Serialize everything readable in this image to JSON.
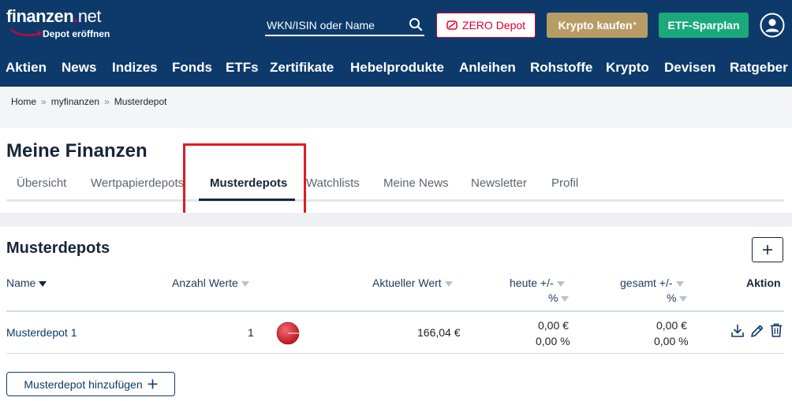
{
  "header": {
    "logo_text_main": "finanzen",
    "logo_text_tld": "net",
    "logo_subtitle": "Depot eröffnen",
    "search_placeholder": "WKN/ISIN oder Name",
    "zero_depot_label": "ZERO Depot",
    "krypto_label": "Krypto kaufen",
    "krypto_sup": "*",
    "etf_label": "ETF-Sparplan",
    "colors": {
      "bg": "#0d3a6b",
      "zero": "#e1002d",
      "krypto": "#b79c66",
      "etf": "#1aa97a"
    }
  },
  "nav": {
    "items": [
      "Aktien",
      "News",
      "Indizes",
      "Fonds",
      "ETFs",
      "Zertifikate",
      "Hebelprodukte",
      "Anleihen",
      "Rohstoffe",
      "Krypto",
      "Devisen",
      "Ratgeber"
    ]
  },
  "breadcrumb": [
    "Home",
    "myfinanzen",
    "Musterdepot"
  ],
  "page": {
    "title": "Meine Finanzen",
    "tabs": [
      "Übersicht",
      "Wertpapierdepots",
      "Musterdepots",
      "Watchlists",
      "Meine News",
      "Newsletter",
      "Profil"
    ],
    "active_tab": "Musterdepots"
  },
  "musterdepots": {
    "title": "Musterdepots",
    "columns": {
      "name": "Name",
      "anzahl": "Anzahl Werte",
      "wert": "Aktueller Wert",
      "heute": "heute +/-",
      "heute_pct": "%",
      "gesamt": "gesamt +/-",
      "gesamt_pct": "%",
      "aktion": "Aktion"
    },
    "rows": [
      {
        "name": "Musterdepot 1",
        "anzahl": "1",
        "wert": "166,04 €",
        "heute_abs": "0,00 €",
        "heute_pct": "0,00 %",
        "gesamt_abs": "0,00 €",
        "gesamt_pct": "0,00 %"
      }
    ],
    "add_button_label": "Musterdepot hinzufügen"
  }
}
